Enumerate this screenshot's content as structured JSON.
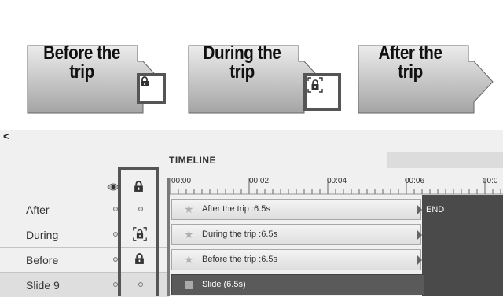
{
  "stage": {
    "slides": [
      {
        "line1": "Before the",
        "line2": "trip",
        "lock": "lock-closed"
      },
      {
        "line1": "During the",
        "line2": "trip",
        "lock": "lock-dashed"
      },
      {
        "line1": "After the",
        "line2": "trip",
        "lock": "none"
      }
    ]
  },
  "timeline": {
    "collapse_label": "<",
    "title": "TIMELINE",
    "ticks": [
      "00:00",
      "00:02",
      "00:04",
      "00:06",
      "00:0"
    ],
    "rows": [
      {
        "name": "After",
        "bar": "After the  trip :6.5s",
        "lock": "dot"
      },
      {
        "name": "During",
        "bar": "During the trip :6.5s",
        "lock": "lock-dashed"
      },
      {
        "name": "Before",
        "bar": "Before the trip :6.5s",
        "lock": "lock-closed"
      },
      {
        "name": "Slide 9",
        "bar": "Slide (6.5s)",
        "lock": "dot"
      }
    ],
    "end_label": "END"
  },
  "colors": {
    "arrow_fill_top": "#e8e8e8",
    "arrow_fill_bottom": "#a8a8a8",
    "dark_track": "#4a4a4a"
  }
}
